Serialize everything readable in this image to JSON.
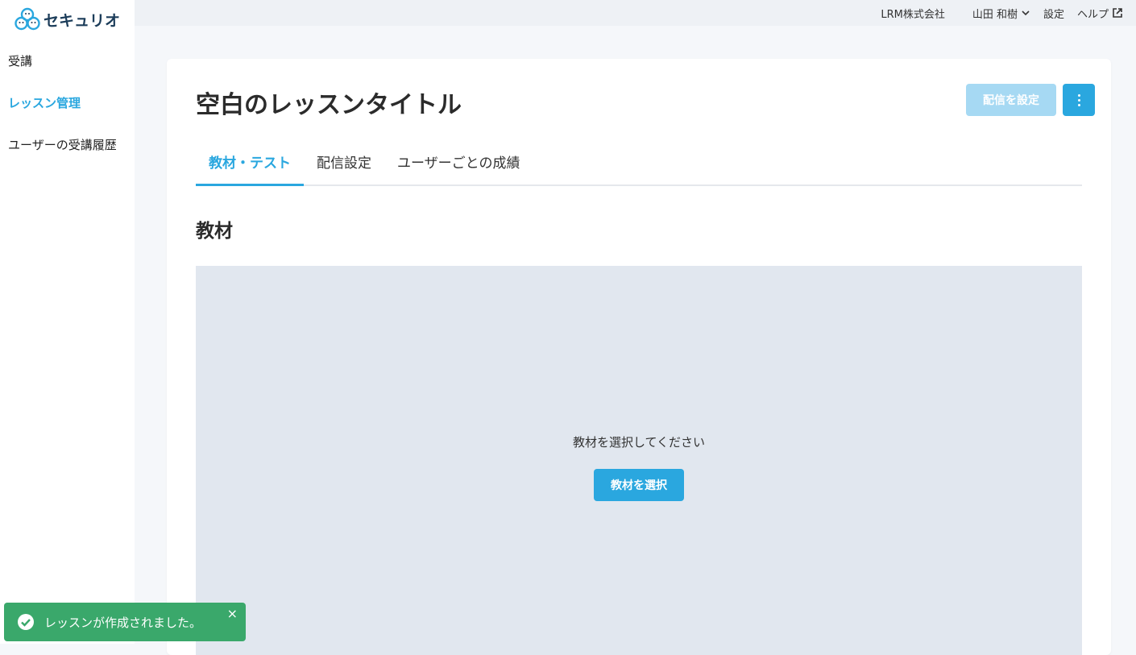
{
  "app": {
    "logo_text": "セキュリオ"
  },
  "sidebar": {
    "items": [
      {
        "label": "受講"
      },
      {
        "label": "レッスン管理"
      },
      {
        "label": "ユーザーの受講履歴"
      }
    ],
    "active_index": 1
  },
  "header": {
    "company": "LRM株式会社",
    "user": "山田 和樹",
    "settings": "設定",
    "help": "ヘルプ"
  },
  "main": {
    "title": "空白のレッスンタイトル",
    "deliver_button": "配信を設定",
    "tabs": [
      {
        "label": "教材・テスト"
      },
      {
        "label": "配信設定"
      },
      {
        "label": "ユーザーごとの成績"
      }
    ],
    "active_tab": 0,
    "section_title": "教材",
    "empty_message": "教材を選択してください",
    "select_button": "教材を選択"
  },
  "toast": {
    "message": "レッスンが作成されました。",
    "close": "×"
  },
  "colors": {
    "accent": "#2aa7df",
    "accent_disabled": "#a6d9f3",
    "toast_success": "#3aa86b",
    "logo": "#1c3d5a"
  }
}
